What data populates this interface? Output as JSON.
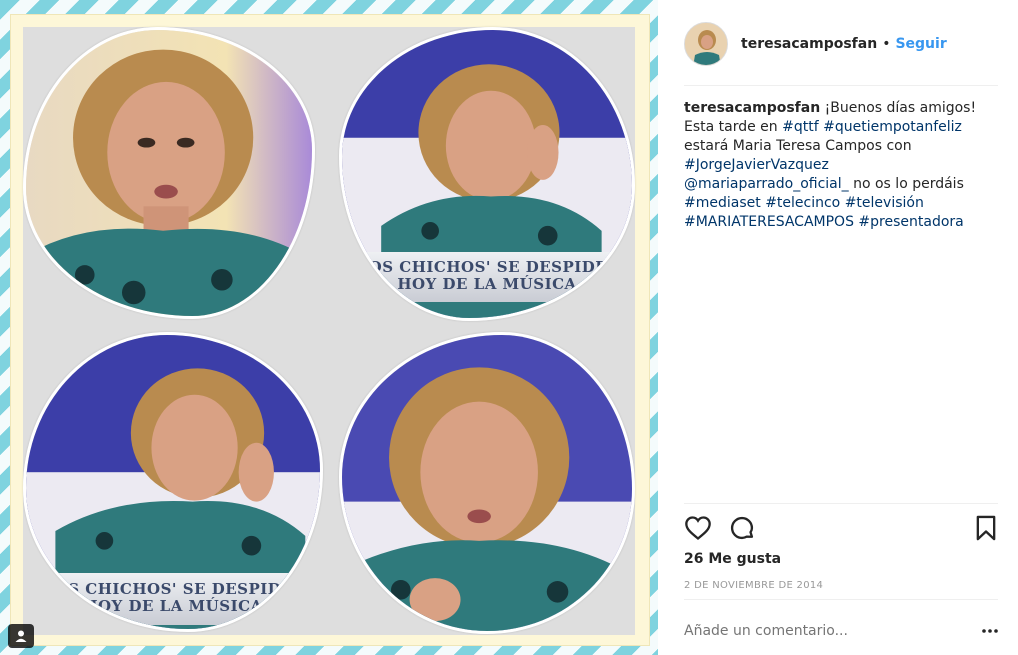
{
  "post": {
    "username": "teresacamposfan",
    "follow_label": "Seguir",
    "separator": "•",
    "caption_parts": [
      {
        "text": "¡Buenos días amigos! Esta tarde en ",
        "link": false
      },
      {
        "text": "#qttf",
        "link": true
      },
      {
        "text": " ",
        "link": false
      },
      {
        "text": "#quetiempotanfeliz",
        "link": true
      },
      {
        "text": " estará Maria Teresa Campos con ",
        "link": false
      },
      {
        "text": "#JorgeJavierVazquez",
        "link": true
      },
      {
        "text": " ",
        "link": false
      },
      {
        "text": "@mariaparrado_oficial_",
        "link": true
      },
      {
        "text": " no os lo perdáis ",
        "link": false
      },
      {
        "text": "#mediaset",
        "link": true
      },
      {
        "text": " ",
        "link": false
      },
      {
        "text": "#telecinco",
        "link": true
      },
      {
        "text": " ",
        "link": false
      },
      {
        "text": "#televisión",
        "link": true
      },
      {
        "text": " ",
        "link": false
      },
      {
        "text": "#MARIATERESACAMPOS",
        "link": true
      },
      {
        "text": " ",
        "link": false
      },
      {
        "text": "#presentadora",
        "link": true
      }
    ],
    "likes": "26 Me gusta",
    "date": "2 DE NOVIEMBRE DE 2014",
    "comment_placeholder": "Añade un comentario...",
    "image_caption_line1": "'LOS CHICHOS' SE DESPIDEN",
    "image_caption_line2": "HOY DE LA MÚSICA",
    "colors": {
      "link": "#003569",
      "follow": "#3897f0",
      "frame_stripe": "#7fd3df",
      "mat": "#fdf7d8"
    },
    "icons": [
      "heart-icon",
      "comment-icon",
      "bookmark-icon",
      "more-options-icon",
      "user-tag-icon"
    ]
  }
}
